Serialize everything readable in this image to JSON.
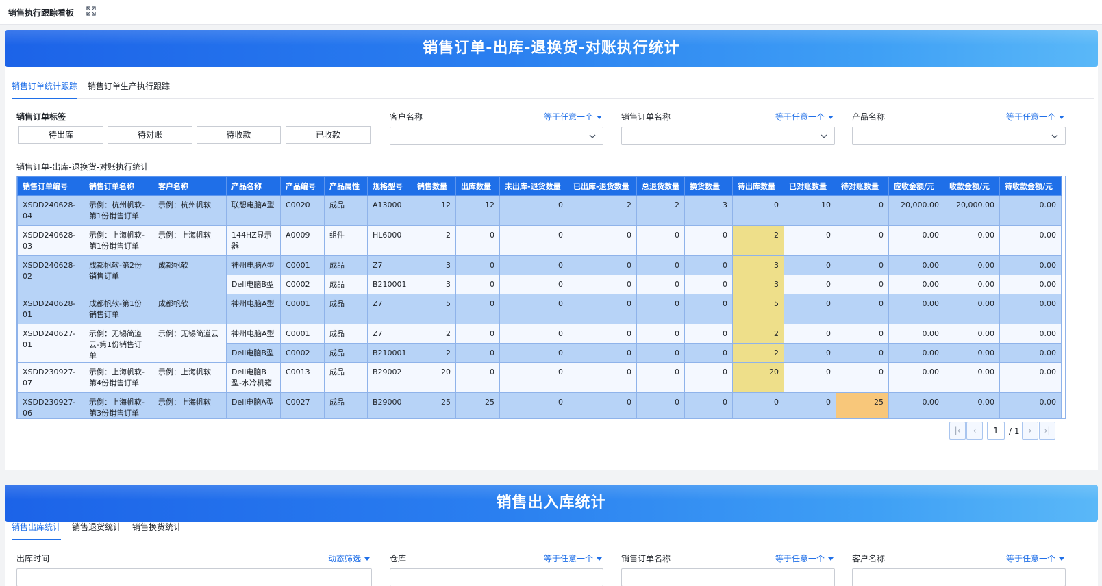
{
  "topbar": {
    "title": "销售执行跟踪看板"
  },
  "panel1": {
    "banner_title": "销售订单-出库-退换货-对账执行统计",
    "tabs": [
      "销售订单统计跟踪",
      "销售订单生产执行跟踪"
    ],
    "tag_label": "销售订单标签",
    "tag_buttons": [
      "待出库",
      "待对账",
      "待收款",
      "已收款"
    ],
    "filters": [
      {
        "label": "客户名称",
        "mode": "等于任意一个"
      },
      {
        "label": "销售订单名称",
        "mode": "等于任意一个"
      },
      {
        "label": "产品名称",
        "mode": "等于任意一个"
      }
    ],
    "table_title": "销售订单-出库-退换货-对账执行统计",
    "columns": [
      "销售订单编号",
      "销售订单名称",
      "客户名称",
      "产品名称",
      "产品编号",
      "产品属性",
      "规格型号",
      "销售数量",
      "出库数量",
      "未出库-退货数量",
      "已出库-退货数量",
      "总退货数量",
      "换货数量",
      "待出库数量",
      "已对账数量",
      "待对账数量",
      "应收金额/元",
      "收款金额/元",
      "待收款金额/元"
    ],
    "orders": [
      {
        "no": "XSDD240628-04",
        "name": "示例：杭州帆软-第1份销售订单",
        "customer": "示例：杭州帆软",
        "items": [
          {
            "cells": [
              "联想电脑A型",
              "C0020",
              "成品",
              "A13000",
              "12",
              "12",
              "0",
              "2",
              "2",
              "3",
              "0",
              "10",
              "0",
              "20,000.00",
              "20,000.00",
              "0.00"
            ]
          }
        ]
      },
      {
        "no": "XSDD240628-03",
        "name": "示例：上海帆软-第1份销售订单",
        "customer": "示例：上海帆软",
        "items": [
          {
            "cells": [
              "144HZ显示器",
              "A0009",
              "组件",
              "HL6000",
              "2",
              "0",
              "0",
              "0",
              "0",
              "0",
              "2",
              "0",
              "0",
              "0.00",
              "0.00",
              "0.00"
            ]
          }
        ]
      },
      {
        "no": "XSDD240628-02",
        "name": "成都帆软-第2份销售订单",
        "customer": "成都帆软",
        "items": [
          {
            "cells": [
              "神州电脑A型",
              "C0001",
              "成品",
              "Z7",
              "3",
              "0",
              "0",
              "0",
              "0",
              "0",
              "3",
              "0",
              "0",
              "0.00",
              "0.00",
              "0.00"
            ]
          },
          {
            "cells": [
              "Dell电脑B型",
              "C0002",
              "成品",
              "B210001",
              "3",
              "0",
              "0",
              "0",
              "0",
              "0",
              "3",
              "0",
              "0",
              "0.00",
              "0.00",
              "0.00"
            ]
          }
        ]
      },
      {
        "no": "XSDD240628-01",
        "name": "成都帆软-第1份销售订单",
        "customer": "成都帆软",
        "items": [
          {
            "cells": [
              "神州电脑A型",
              "C0001",
              "成品",
              "Z7",
              "5",
              "0",
              "0",
              "0",
              "0",
              "0",
              "5",
              "0",
              "0",
              "0.00",
              "0.00",
              "0.00"
            ]
          }
        ]
      },
      {
        "no": "XSDD240627-01",
        "name": "示例：无锡简道云-第1份销售订单",
        "customer": "示例：无锡简道云",
        "items": [
          {
            "cells": [
              "神州电脑A型",
              "C0001",
              "成品",
              "Z7",
              "2",
              "0",
              "0",
              "0",
              "0",
              "0",
              "2",
              "0",
              "0",
              "0.00",
              "0.00",
              "0.00"
            ]
          },
          {
            "cells": [
              "Dell电脑B型",
              "C0002",
              "成品",
              "B210001",
              "2",
              "0",
              "0",
              "0",
              "0",
              "0",
              "2",
              "0",
              "0",
              "0.00",
              "0.00",
              "0.00"
            ]
          }
        ]
      },
      {
        "no": "XSDD230927-07",
        "name": "示例：上海帆软-第4份销售订单",
        "customer": "示例：上海帆软",
        "items": [
          {
            "cells": [
              "Dell电脑B型-水冷机箱",
              "C0013",
              "成品",
              "B29002",
              "20",
              "0",
              "0",
              "0",
              "0",
              "0",
              "20",
              "0",
              "0",
              "0.00",
              "0.00",
              "0.00"
            ]
          }
        ]
      },
      {
        "no": "XSDD230927-06",
        "name": "示例：上海帆软-第3份销售订单",
        "customer": "示例：上海帆软",
        "items": [
          {
            "cells": [
              "Dell电脑A型",
              "C0027",
              "成品",
              "B29000",
              "25",
              "25",
              "0",
              "0",
              "0",
              "0",
              "0",
              "0",
              "25",
              "0.00",
              "0.00",
              "0.00"
            ]
          }
        ]
      }
    ],
    "pager": {
      "current": "1",
      "total": "/ 1"
    }
  },
  "panel2": {
    "banner_title": "销售出入库统计",
    "tabs": [
      "销售出库统计",
      "销售退货统计",
      "销售换货统计"
    ],
    "filters": [
      {
        "label": "出库时间",
        "mode": "动态筛选"
      },
      {
        "label": "仓库",
        "mode": "等于任意一个"
      },
      {
        "label": "销售订单名称",
        "mode": "等于任意一个"
      },
      {
        "label": "客户名称",
        "mode": "等于任意一个"
      }
    ]
  },
  "colors": {
    "accent": "#1f6fe8",
    "row_blue": "#b7d3f7",
    "highlight_yellow": "#eedf8a",
    "highlight_orange": "#f8c77a"
  }
}
